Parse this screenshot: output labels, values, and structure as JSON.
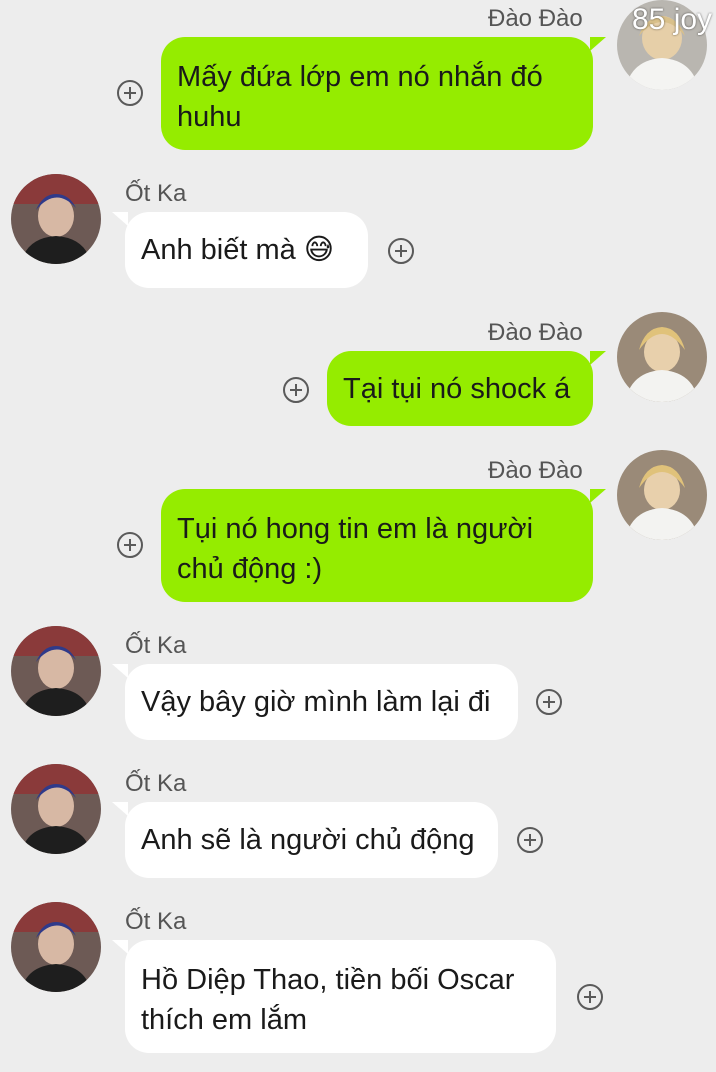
{
  "watermark": "85 joy",
  "messages": [
    {
      "sender": "Đào Đào",
      "side": "right",
      "text": "Mấy đứa lớp em nó nhắn đó huhu"
    },
    {
      "sender": "Ốt Ka",
      "side": "left",
      "text": "Anh biết mà 😅"
    },
    {
      "sender": "Đào Đào",
      "side": "right",
      "text": "Tại tụi nó shock á"
    },
    {
      "sender": "Đào Đào",
      "side": "right",
      "text": "Tụi nó hong tin em là người chủ động :)"
    },
    {
      "sender": "Ốt Ka",
      "side": "left",
      "text": "Vậy bây giờ mình làm lại đi"
    },
    {
      "sender": "Ốt Ka",
      "side": "left",
      "text": "Anh sẽ là người chủ động"
    },
    {
      "sender": "Ốt Ka",
      "side": "left",
      "text": "Hồ Diệp Thao, tiền bối Oscar thích em lắm"
    }
  ],
  "icons": {
    "add": "plus-circle-icon",
    "avatar_right": "user-avatar-blonde",
    "avatar_left": "user-avatar-dark"
  },
  "colors": {
    "background": "#ededed",
    "sent_bubble": "#95ec00",
    "received_bubble": "#ffffff"
  }
}
